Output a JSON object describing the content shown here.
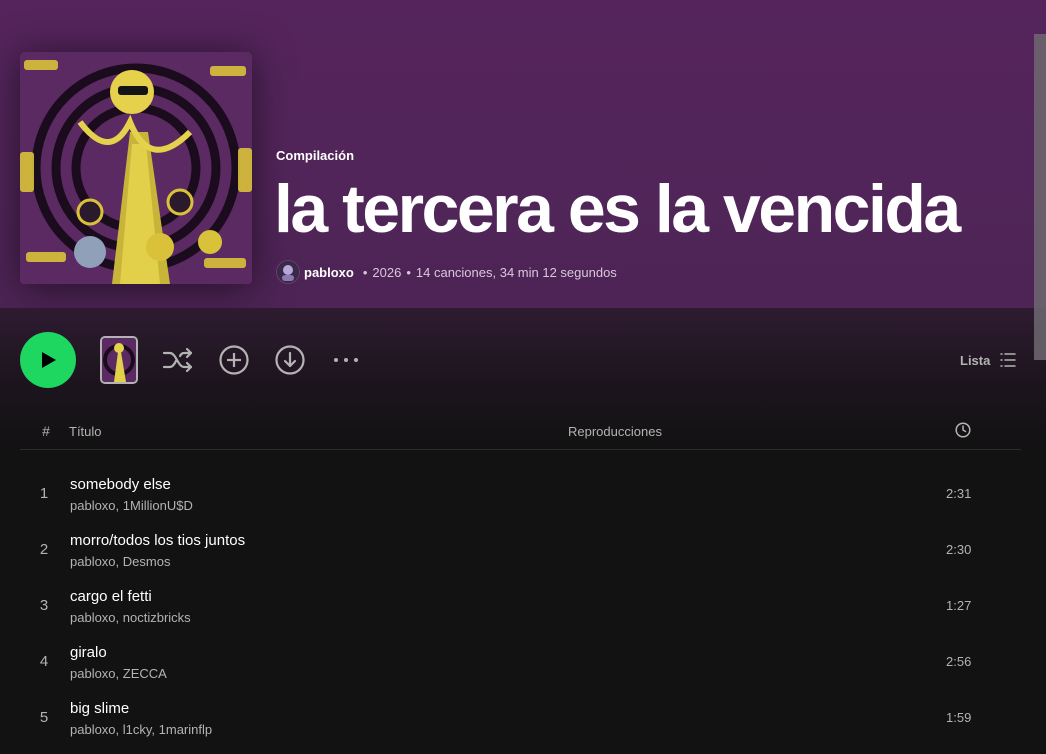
{
  "header": {
    "type_label": "Compilación",
    "title": "la tercera es la vencida",
    "artist": "pabloxo",
    "year": "2026",
    "stats": "14 canciones, 34 min 12 segundos",
    "separator": "•"
  },
  "controls": {
    "view_label": "Lista",
    "icons": [
      "play-icon",
      "shuffle-icon",
      "add-circle-icon",
      "download-circle-icon",
      "more-icon",
      "list-view-icon"
    ]
  },
  "table": {
    "col_num": "#",
    "col_title": "Título",
    "col_plays": "Reproducciones",
    "col_duration_icon": "clock-icon"
  },
  "tracks": [
    {
      "num": "1",
      "title": "somebody else",
      "artists": "pabloxo, 1MillionU$D",
      "duration": "2:31"
    },
    {
      "num": "2",
      "title": "morro/todos los tios juntos",
      "artists": "pabloxo, Desmos",
      "duration": "2:30"
    },
    {
      "num": "3",
      "title": "cargo el fetti",
      "artists": "pabloxo, noctizbricks",
      "duration": "1:27"
    },
    {
      "num": "4",
      "title": "giralo",
      "artists": "pabloxo, ZECCA",
      "duration": "2:56"
    },
    {
      "num": "5",
      "title": "big slime",
      "artists": "pabloxo, l1cky, 1marinflp",
      "duration": "1:59"
    }
  ],
  "colors": {
    "accent": "#1ed760",
    "header_bg": "#55245c",
    "page_bg": "#121212",
    "secondary_text": "#b3b3b3"
  }
}
